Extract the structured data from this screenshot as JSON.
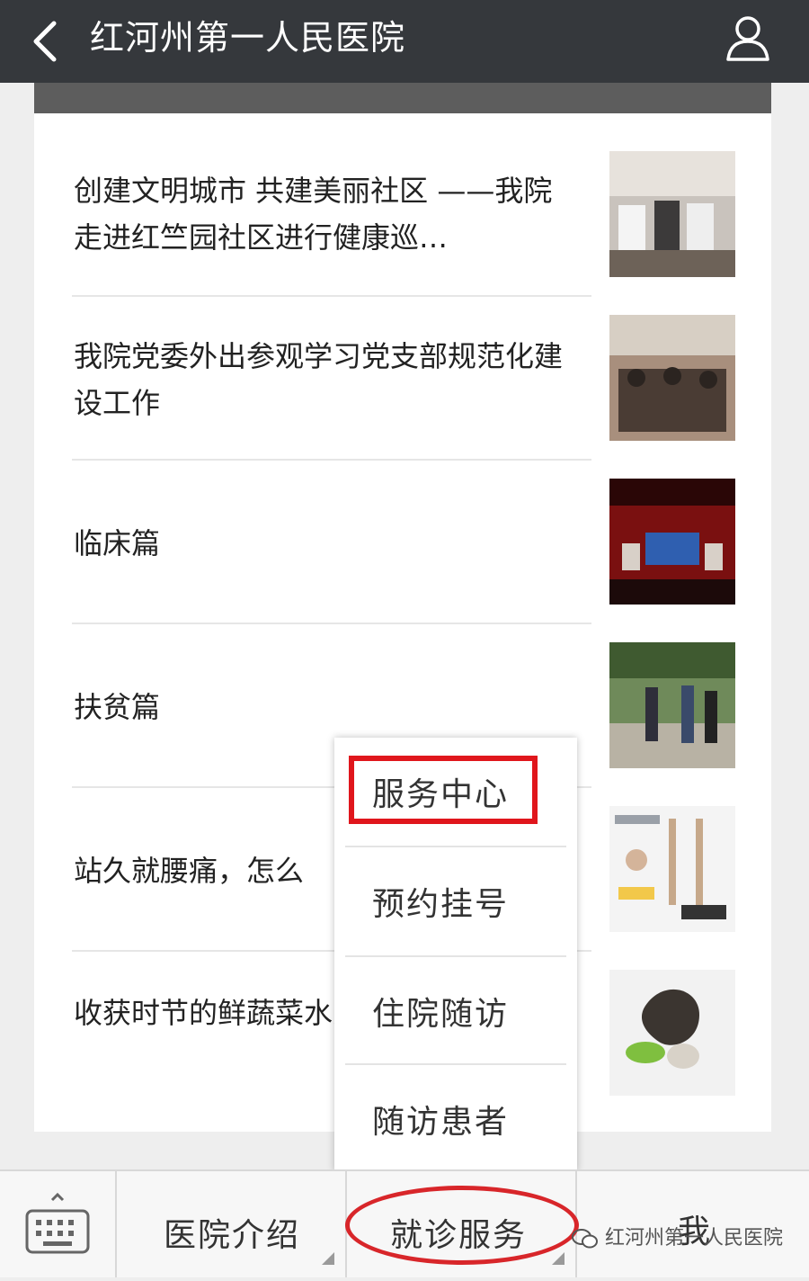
{
  "header": {
    "title": "红河州第一人民医院",
    "back_icon": "chevron-left-icon",
    "profile_icon": "user-icon"
  },
  "articles": [
    {
      "title": "创建文明城市 共建美丽社区 ——我院走进红竺园社区进行健康巡…"
    },
    {
      "title": "我院党委外出参观学习党支部规范化建设工作"
    },
    {
      "title": "临床篇"
    },
    {
      "title": "扶贫篇"
    },
    {
      "title": "站久就腰痛，怎么"
    },
    {
      "title": "收获时节的鲜蔬菜水为载体，为忙碌"
    }
  ],
  "popup_menu": {
    "items": [
      "服务中心",
      "预约挂号",
      "住院随访",
      "随访患者"
    ],
    "highlighted_index": 0
  },
  "bottom_menu": {
    "keyboard_icon": "keyboard-icon",
    "tabs": [
      "医院介绍",
      "就诊服务",
      "我"
    ],
    "active_tab_index": 1
  },
  "watermark": {
    "text": "红河州第一人民医院",
    "icon": "wechat-icon"
  },
  "colors": {
    "header_bg": "#35383c",
    "highlight_red": "#e0161c",
    "card_bg": "#ffffff"
  }
}
